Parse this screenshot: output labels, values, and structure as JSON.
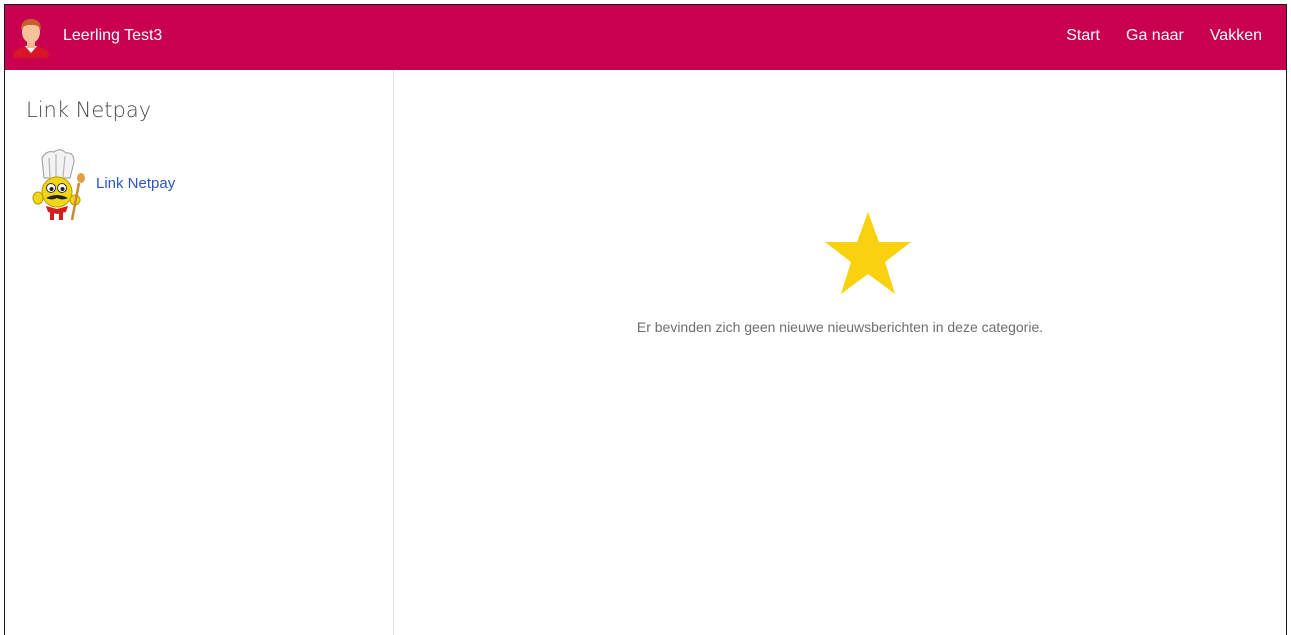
{
  "header": {
    "user_name": "Leerling Test3",
    "nav": {
      "start": "Start",
      "ga_naar": "Ga naar",
      "vakken": "Vakken"
    },
    "avatar_icon": "student-avatar-icon",
    "background_color": "#c8004f"
  },
  "sidebar": {
    "title": "Link Netpay",
    "link": {
      "label": "Link Netpay",
      "icon": "chef-mascot-icon"
    }
  },
  "main": {
    "icon": "star-icon",
    "icon_color": "#f9d10f",
    "empty_message": "Er bevinden zich geen nieuwe nieuwsberichten in deze categorie."
  }
}
